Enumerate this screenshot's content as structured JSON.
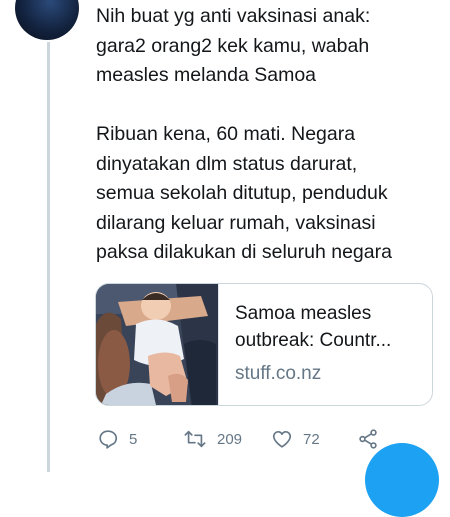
{
  "tweet": {
    "paragraphs": [
      [
        "Nih buat yg anti vaksinasi anak:",
        "gara2 orang2 kek kamu, wabah",
        "measles melanda Samoa"
      ],
      [
        "Ribuan kena, 60 mati. Negara",
        "dinyatakan dlm status darurat,",
        "semua sekolah ditutup, penduduk",
        "dilarang keluar rumah, vaksinasi",
        "paksa dilakukan di seluruh negara"
      ]
    ]
  },
  "card": {
    "title_lines": [
      "Samoa measles",
      "outbreak: Countr..."
    ],
    "domain": "stuff.co.nz"
  },
  "actions": {
    "reply_count": "5",
    "retweet_count": "209",
    "like_count": "72"
  },
  "colors": {
    "text": "#14171a",
    "muted": "#657786",
    "border": "#ccd6dd",
    "accent": "#1da1f2"
  }
}
